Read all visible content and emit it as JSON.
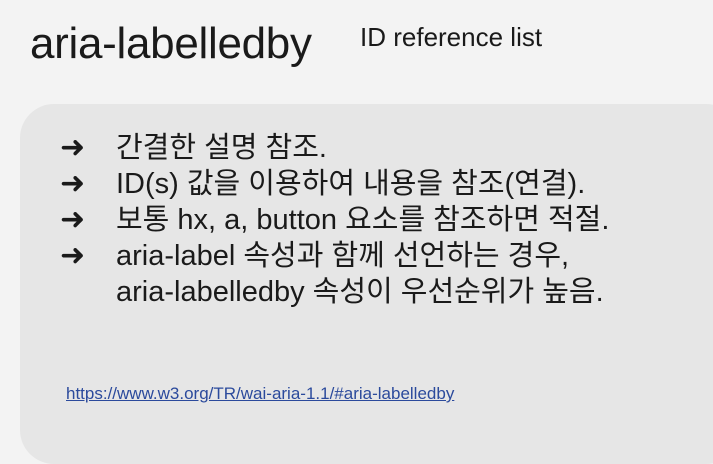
{
  "title": {
    "main": "aria-labelledby",
    "superscript": "ID reference list"
  },
  "icons": {
    "bullet": "right-arrow-icon",
    "arrow_glyph": "➜"
  },
  "bullets": [
    {
      "lines": [
        "간결한 설명 참조."
      ]
    },
    {
      "lines": [
        "ID(s) 값을 이용하여 내용을 참조(연결)."
      ]
    },
    {
      "lines": [
        "보통 hx, a, button 요소를 참조하면 적절."
      ]
    },
    {
      "lines": [
        "aria-label 속성과 함께 선언하는 경우,",
        "aria-labelledby 속성이 우선순위가 높음."
      ]
    }
  ],
  "link": {
    "text": "https://www.w3.org/TR/wai-aria-1.1/#aria-labelledby"
  },
  "colors": {
    "background": "#f3f3f3",
    "panel": "#e6e6e6",
    "link": "#2b4a9c",
    "text": "#1a1a1a"
  }
}
